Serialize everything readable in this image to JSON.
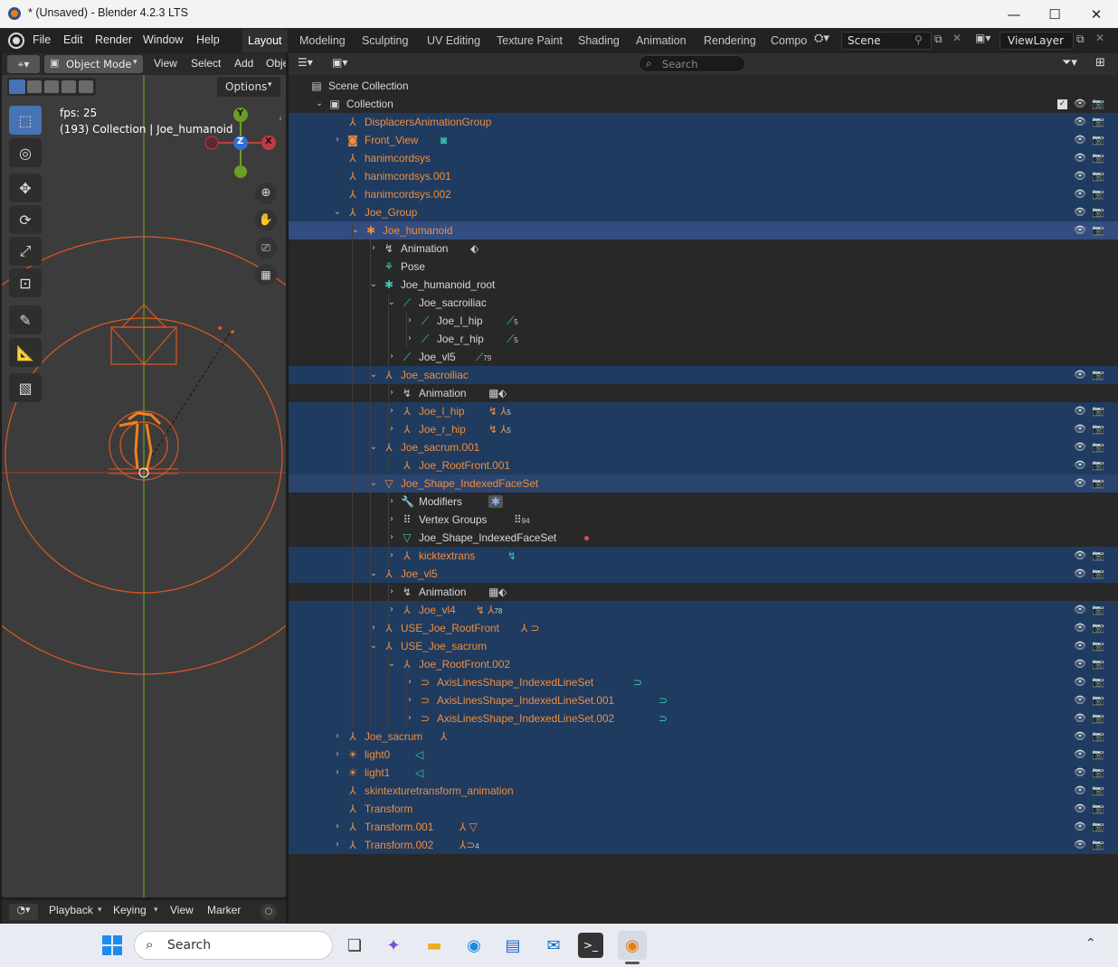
{
  "titlebar": {
    "title": "* (Unsaved) - Blender 4.2.3 LTS",
    "minimize": "—",
    "maximize": "☐",
    "close": "✕"
  },
  "menubar": [
    "File",
    "Edit",
    "Render",
    "Window",
    "Help"
  ],
  "workspaces": [
    "Layout",
    "Modeling",
    "Sculpting",
    "UV Editing",
    "Texture Paint",
    "Shading",
    "Animation",
    "Rendering",
    "Compo"
  ],
  "scene": {
    "label": "Scene",
    "viewlayer": "ViewLayer"
  },
  "viewport": {
    "mode": "Object Mode",
    "menus": [
      "View",
      "Select",
      "Add",
      "Obje"
    ],
    "options": "Options",
    "fps": "fps: 25",
    "info": "(193) Collection | Joe_humanoid",
    "gizmo": {
      "x": "X",
      "y": "Y",
      "z": "Z"
    }
  },
  "outliner": {
    "search_placeholder": "Search",
    "rows": [
      {
        "t": "Scene Collection",
        "d": 0,
        "c": "white",
        "icon": "scene",
        "bg": "none",
        "exp": ""
      },
      {
        "t": "Collection",
        "d": 1,
        "c": "white",
        "icon": "collection",
        "bg": "none",
        "exp": "v",
        "chk": true
      },
      {
        "t": "DisplacersAnimationGroup",
        "d": 2,
        "c": "orange",
        "icon": "empty",
        "bg": "sel",
        "exp": ""
      },
      {
        "t": "Front_View",
        "d": 2,
        "c": "orange",
        "icon": "camera",
        "bg": "sel",
        "exp": ">",
        "extra": "camera-data"
      },
      {
        "t": "hanimcordsys",
        "d": 2,
        "c": "orange",
        "icon": "empty",
        "bg": "sel",
        "exp": ""
      },
      {
        "t": "hanimcordsys.001",
        "d": 2,
        "c": "orange",
        "icon": "empty",
        "bg": "sel",
        "exp": ""
      },
      {
        "t": "hanimcordsys.002",
        "d": 2,
        "c": "orange",
        "icon": "empty",
        "bg": "sel",
        "exp": ""
      },
      {
        "t": "Joe_Group",
        "d": 2,
        "c": "orange",
        "icon": "empty",
        "bg": "sel",
        "exp": "v"
      },
      {
        "t": "Joe_humanoid",
        "d": 3,
        "c": "orange",
        "icon": "armature",
        "bg": "act",
        "exp": "v"
      },
      {
        "t": "Animation",
        "d": 4,
        "c": "white",
        "icon": "anim",
        "bg": "none",
        "exp": ">",
        "extra": "action"
      },
      {
        "t": "Pose",
        "d": 4,
        "c": "white",
        "icon": "pose",
        "bg": "none",
        "exp": ""
      },
      {
        "t": "Joe_humanoid_root",
        "d": 4,
        "c": "white",
        "icon": "armdata",
        "bg": "none",
        "exp": "v"
      },
      {
        "t": "Joe_sacroiliac",
        "d": 5,
        "c": "white",
        "icon": "bone",
        "bg": "none",
        "exp": "v"
      },
      {
        "t": "Joe_l_hip",
        "d": 6,
        "c": "white",
        "icon": "bone",
        "bg": "none",
        "exp": ">",
        "extra": "bone",
        "sub": "5"
      },
      {
        "t": "Joe_r_hip",
        "d": 6,
        "c": "white",
        "icon": "bone",
        "bg": "none",
        "exp": ">",
        "extra": "bone",
        "sub": "5"
      },
      {
        "t": "Joe_vl5",
        "d": 5,
        "c": "white",
        "icon": "bone",
        "bg": "none",
        "exp": ">",
        "extra": "bone",
        "sub": "79"
      },
      {
        "t": "Joe_sacroiliac",
        "d": 4,
        "c": "orange",
        "icon": "empty",
        "bg": "sel",
        "exp": "v"
      },
      {
        "t": "Animation",
        "d": 5,
        "c": "white",
        "icon": "anim",
        "bg": "none",
        "exp": ">",
        "extra": "nla"
      },
      {
        "t": "Joe_l_hip",
        "d": 5,
        "c": "orange",
        "icon": "empty",
        "bg": "sel",
        "exp": ">",
        "extra": "anim-empty",
        "sub": "5"
      },
      {
        "t": "Joe_r_hip",
        "d": 5,
        "c": "orange",
        "icon": "empty",
        "bg": "sel",
        "exp": ">",
        "extra": "anim-empty",
        "sub": "5"
      },
      {
        "t": "Joe_sacrum.001",
        "d": 4,
        "c": "orange",
        "icon": "empty",
        "bg": "sel",
        "exp": "v"
      },
      {
        "t": "Joe_RootFront.001",
        "d": 5,
        "c": "orange",
        "icon": "empty",
        "bg": "sel",
        "exp": ""
      },
      {
        "t": "Joe_Shape_IndexedFaceSet",
        "d": 4,
        "c": "orange",
        "icon": "mesh",
        "bg": "act2",
        "exp": "v"
      },
      {
        "t": "Modifiers",
        "d": 5,
        "c": "white",
        "icon": "wrench",
        "bg": "none",
        "exp": ">",
        "extra": "armmod"
      },
      {
        "t": "Vertex Groups",
        "d": 5,
        "c": "white",
        "icon": "vgroup",
        "bg": "none",
        "exp": ">",
        "extra": "vgroup",
        "sub": "94"
      },
      {
        "t": "Joe_Shape_IndexedFaceSet",
        "d": 5,
        "c": "white",
        "icon": "meshdata",
        "bg": "none",
        "exp": ">",
        "extra": "material"
      },
      {
        "t": "kicktextrans",
        "d": 5,
        "c": "orange",
        "icon": "empty",
        "bg": "sel",
        "exp": ">",
        "extra": "anim"
      },
      {
        "t": "Joe_vl5",
        "d": 4,
        "c": "orange",
        "icon": "empty",
        "bg": "sel",
        "exp": "v"
      },
      {
        "t": "Animation",
        "d": 5,
        "c": "white",
        "icon": "anim",
        "bg": "none",
        "exp": ">",
        "extra": "nla"
      },
      {
        "t": "Joe_vl4",
        "d": 5,
        "c": "orange",
        "icon": "empty",
        "bg": "sel",
        "exp": ">",
        "extra": "anim-empty",
        "sub": "78"
      },
      {
        "t": "USE_Joe_RootFront",
        "d": 4,
        "c": "orange",
        "icon": "empty",
        "bg": "sel",
        "exp": ">",
        "extra": "empty-curve"
      },
      {
        "t": "USE_Joe_sacrum",
        "d": 4,
        "c": "orange",
        "icon": "empty",
        "bg": "sel",
        "exp": "v"
      },
      {
        "t": "Joe_RootFront.002",
        "d": 5,
        "c": "orange",
        "icon": "empty",
        "bg": "sel",
        "exp": "v"
      },
      {
        "t": "AxisLinesShape_IndexedLineSet",
        "d": 6,
        "c": "orange",
        "icon": "curve",
        "bg": "sel",
        "exp": ">",
        "extra": "curvedata"
      },
      {
        "t": "AxisLinesShape_IndexedLineSet.001",
        "d": 6,
        "c": "orange",
        "icon": "curve",
        "bg": "sel",
        "exp": ">",
        "extra": "curvedata"
      },
      {
        "t": "AxisLinesShape_IndexedLineSet.002",
        "d": 6,
        "c": "orange",
        "icon": "curve",
        "bg": "sel",
        "exp": ">",
        "extra": "curvedata"
      },
      {
        "t": "Joe_sacrum",
        "d": 2,
        "c": "orange",
        "icon": "empty",
        "bg": "sel",
        "exp": ">",
        "extra": "empty"
      },
      {
        "t": "light0",
        "d": 2,
        "c": "orange",
        "icon": "light",
        "bg": "sel",
        "exp": ">",
        "extra": "lightdata"
      },
      {
        "t": "light1",
        "d": 2,
        "c": "orange",
        "icon": "light",
        "bg": "sel",
        "exp": ">",
        "extra": "lightdata"
      },
      {
        "t": "skintexturetransform_animation",
        "d": 2,
        "c": "orange",
        "icon": "empty",
        "bg": "sel",
        "exp": ""
      },
      {
        "t": "Transform",
        "d": 2,
        "c": "orange",
        "icon": "empty",
        "bg": "sel",
        "exp": ""
      },
      {
        "t": "Transform.001",
        "d": 2,
        "c": "orange",
        "icon": "empty",
        "bg": "sel",
        "exp": ">",
        "extra": "empty-mesh"
      },
      {
        "t": "Transform.002",
        "d": 2,
        "c": "orange",
        "icon": "empty",
        "bg": "sel",
        "exp": ">",
        "extra": "empty-curve4",
        "sub": "4"
      }
    ]
  },
  "timeline": {
    "menus": [
      "Playback",
      "Keying",
      "View",
      "Marker"
    ]
  },
  "taskbar": {
    "search": "Search"
  },
  "colors": {
    "accent": "#f28e3c",
    "selected_row": "#1f3b60",
    "active_row": "#334d80",
    "bone": "#3cc8b4"
  }
}
